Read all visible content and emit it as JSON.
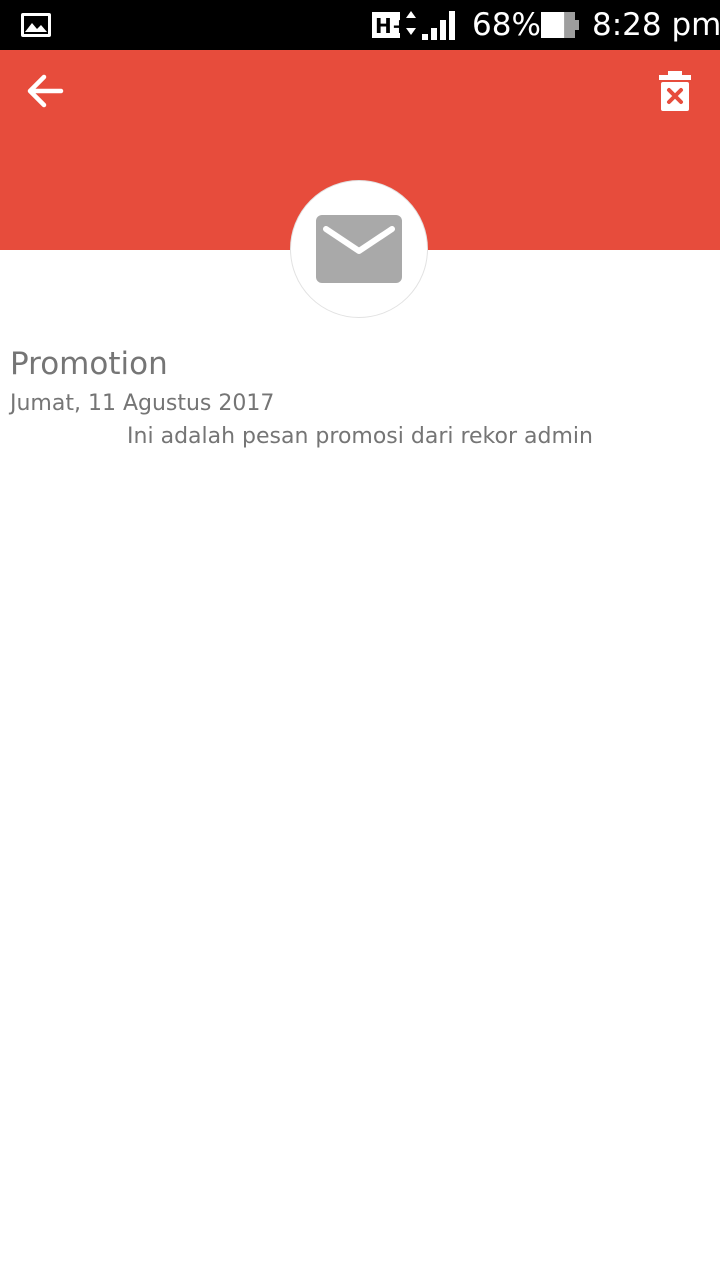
{
  "status_bar": {
    "notification_icon": "gallery-icon",
    "network_type": "H+",
    "battery_percent": "68%",
    "battery_level": 0.68,
    "time": "8:28 pm"
  },
  "app_bar": {
    "background_color": "#e74c3c",
    "back_icon": "arrow-left-icon",
    "delete_icon": "trash-x-icon"
  },
  "message": {
    "avatar_icon": "envelope-icon",
    "title": "Promotion",
    "date": "Jumat, 11 Agustus 2017",
    "body": "Ini adalah pesan promosi dari rekor admin"
  }
}
